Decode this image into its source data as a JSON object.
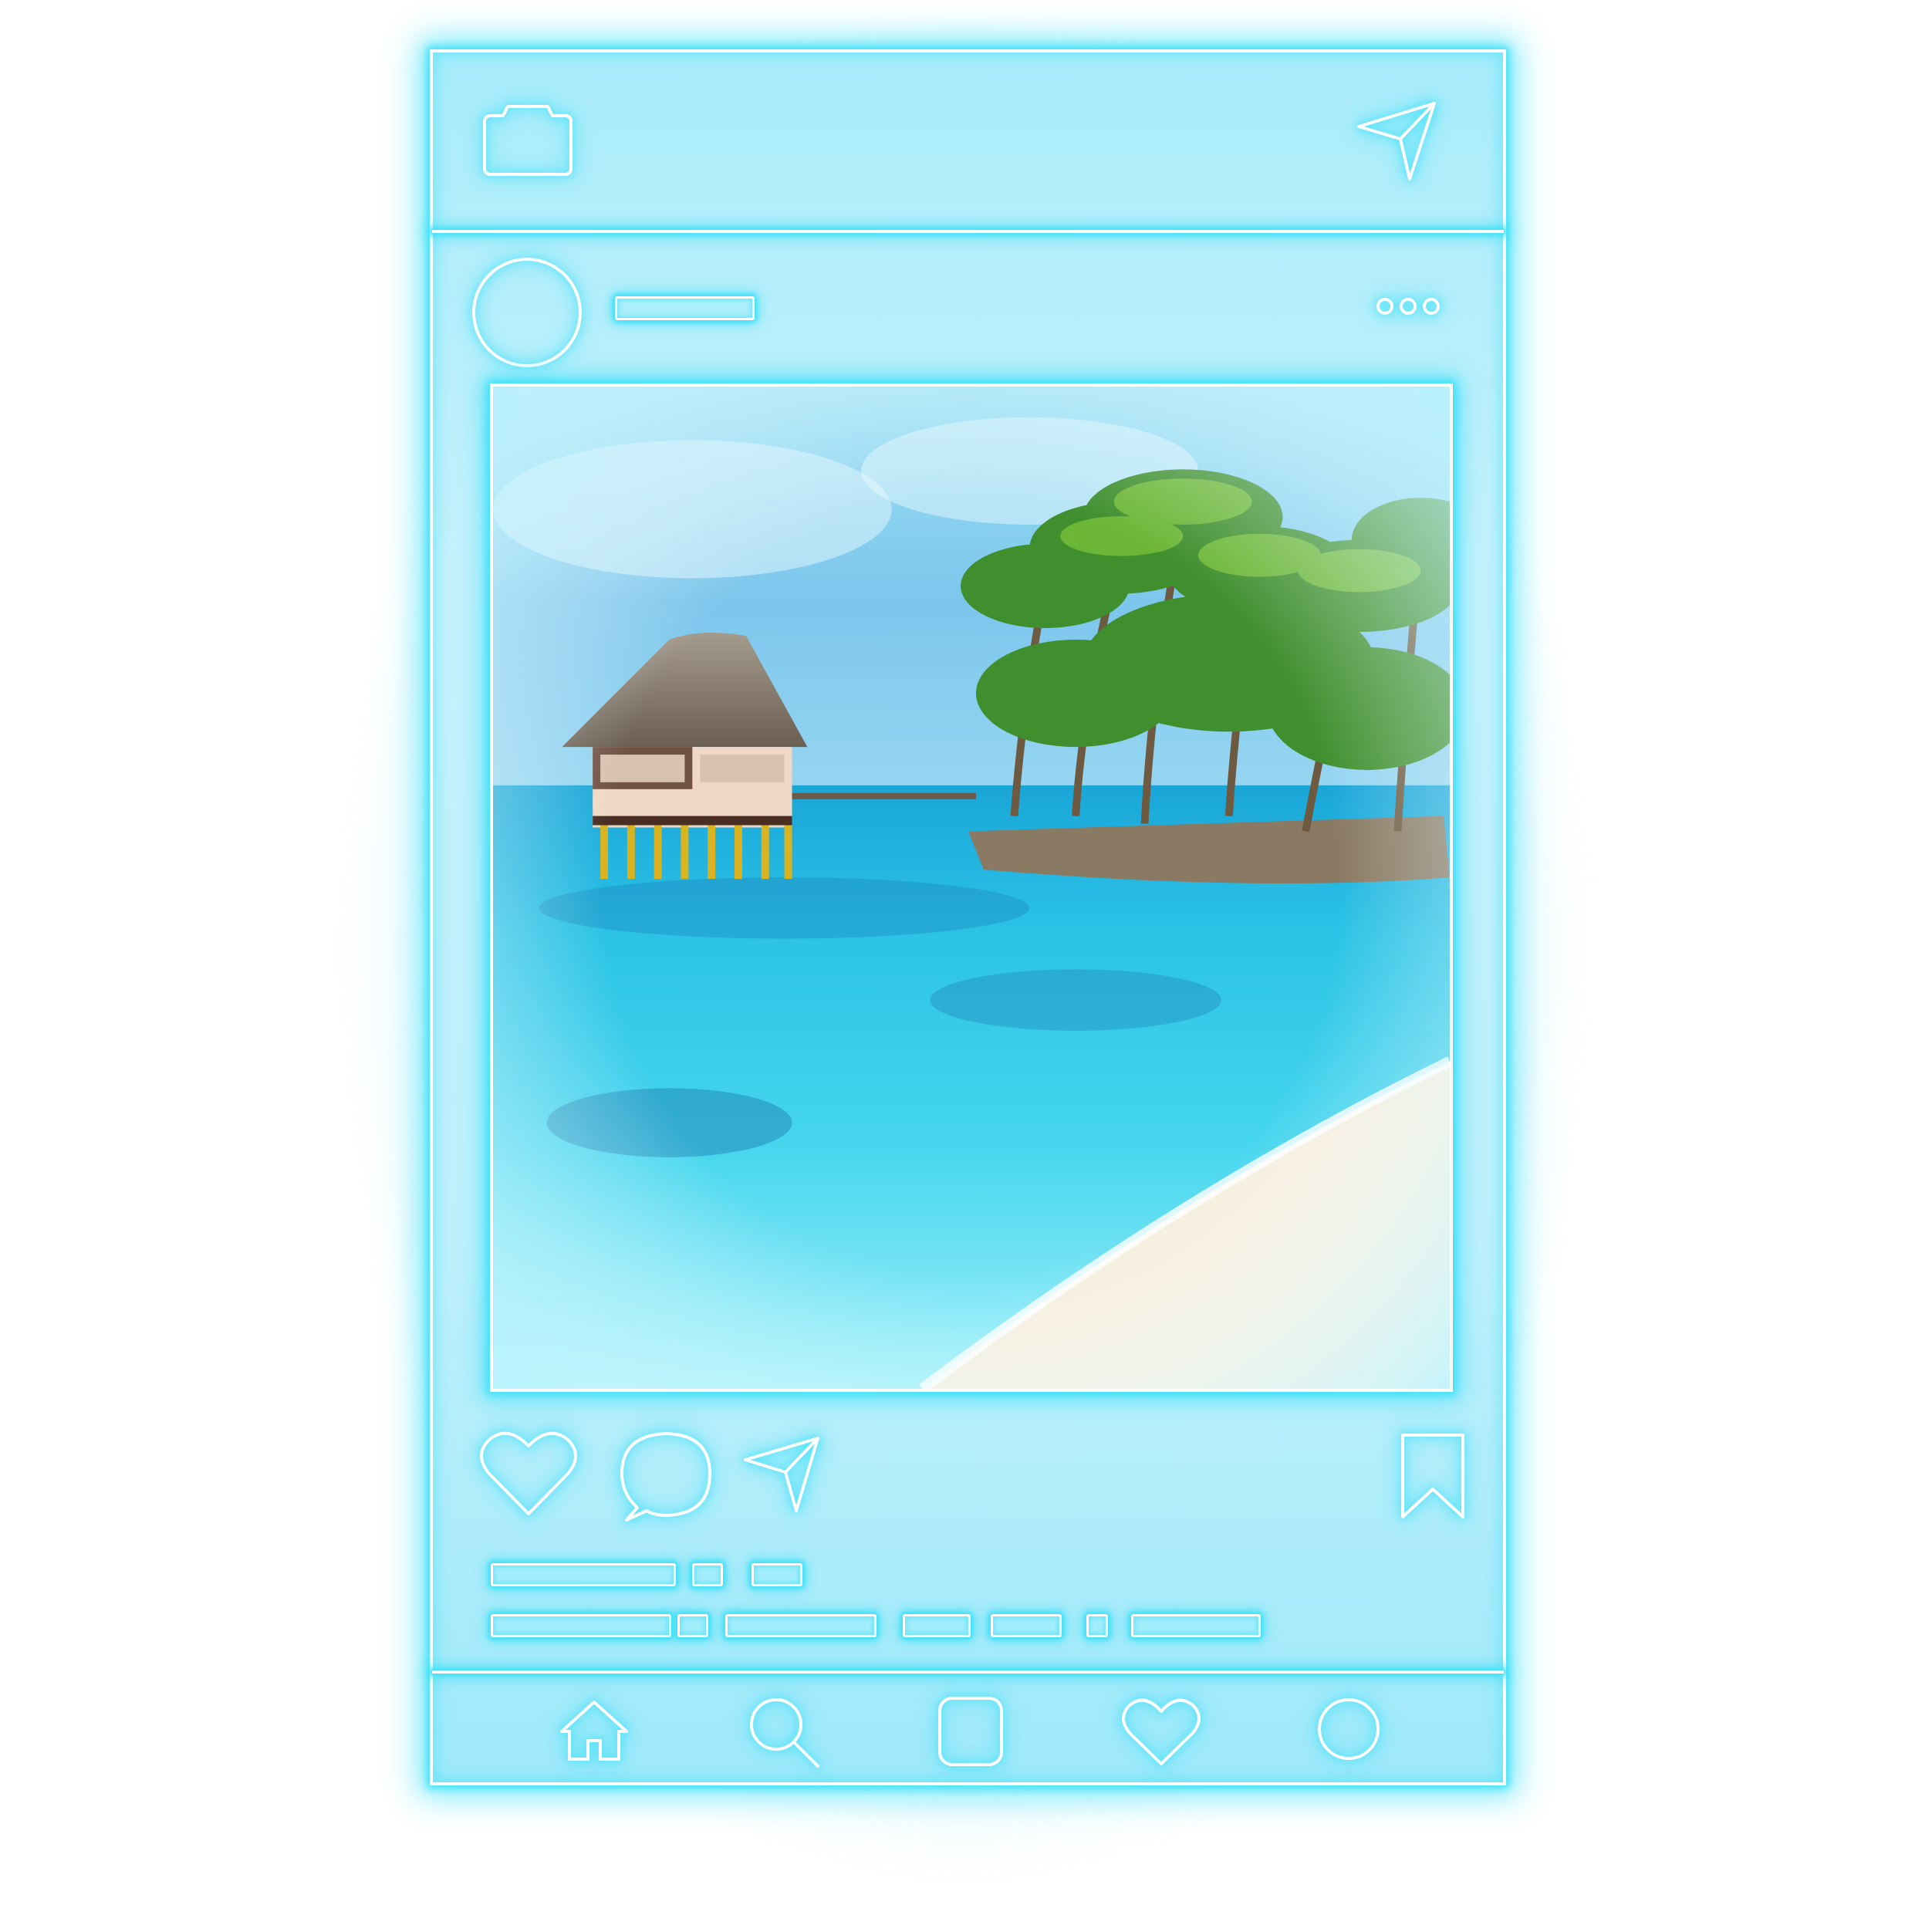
{
  "app": {
    "name": "neon-social-post-frame"
  },
  "colors": {
    "neon": "#3fe1f8",
    "stroke": "#ffffff",
    "panel": "#bff0fc",
    "sky": "#78c6ee",
    "sea": "#2ec7e6",
    "sand": "#f4efe2"
  },
  "header": {
    "left_icon": "camera-icon",
    "right_icon": "send-icon"
  },
  "post": {
    "avatar_icon": "profile-avatar-placeholder",
    "username_placeholder_icon": "username-bar",
    "menu_icon": "more-dots-icon",
    "photo": {
      "subject": "tropical-beach-with-stilt-hut-and-palm-trees"
    },
    "actions": {
      "like_icon": "heart-icon",
      "comment_icon": "comment-icon",
      "share_icon": "send-icon",
      "save_icon": "bookmark-icon"
    },
    "caption_placeholders": {
      "line1_bars": 3,
      "line2_bars": 7
    }
  },
  "bottom_nav": {
    "items": [
      {
        "icon": "home-icon"
      },
      {
        "icon": "search-icon"
      },
      {
        "icon": "add-post-icon"
      },
      {
        "icon": "activity-heart-icon"
      },
      {
        "icon": "profile-icon"
      }
    ]
  }
}
